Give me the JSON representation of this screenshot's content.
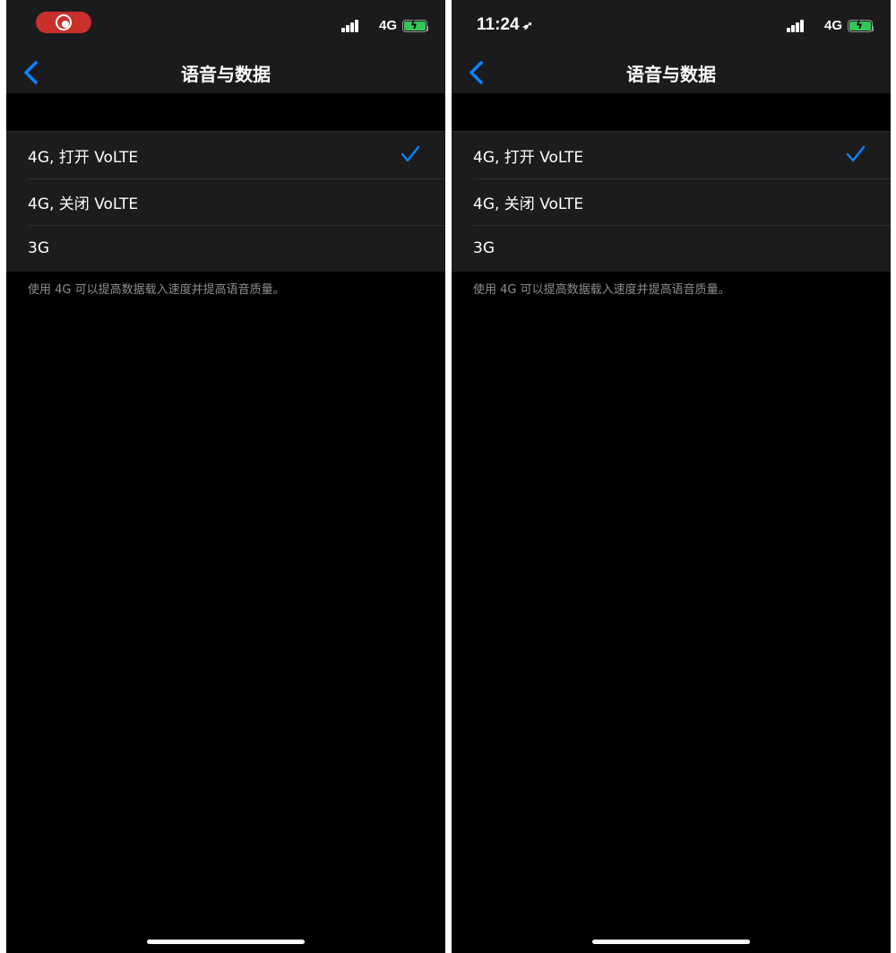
{
  "screens": [
    {
      "status": {
        "time": "",
        "network": "4G",
        "recording": true
      },
      "nav": {
        "back_icon": "chevron-left-icon",
        "title": "语音与数据"
      },
      "options": [
        {
          "label": "4G, 打开 VoLTE",
          "selected": true
        },
        {
          "label": "4G, 关闭 VoLTE",
          "selected": false
        },
        {
          "label": "3G",
          "selected": false
        }
      ],
      "footer": "使用 4G 可以提高数据载入速度并提高语音质量。"
    },
    {
      "status": {
        "time": "11:24",
        "network": "4G",
        "recording": false
      },
      "nav": {
        "back_icon": "chevron-left-icon",
        "title": "语音与数据"
      },
      "options": [
        {
          "label": "4G, 打开 VoLTE",
          "selected": true
        },
        {
          "label": "4G, 关闭 VoLTE",
          "selected": false
        },
        {
          "label": "3G",
          "selected": false
        }
      ],
      "footer": "使用 4G 可以提高数据载入速度并提高语音质量。"
    }
  ],
  "colors": {
    "accent": "#0a84ff",
    "battery": "#33c759",
    "record": "#c9302c"
  }
}
